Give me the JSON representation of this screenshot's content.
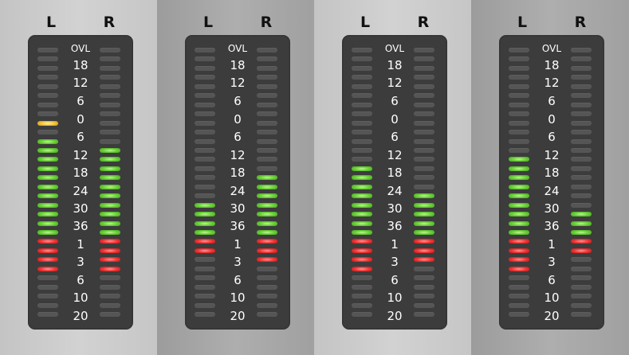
{
  "channel_labels": {
    "left": "L",
    "right": "R"
  },
  "scale_labels": [
    "OVL",
    "18",
    "12",
    "6",
    "0",
    "6",
    "12",
    "18",
    "24",
    "30",
    "36",
    "1",
    "3",
    "6",
    "10",
    "20"
  ],
  "segment_colors": {
    "off": "#555555",
    "green": "#6fd43c",
    "yellow": "#f3c339",
    "red": "#ee3737"
  },
  "meters": [
    {
      "left": {
        "lit": 11,
        "red": 4
      },
      "right": {
        "lit": 10,
        "red": 4
      }
    },
    {
      "left": {
        "lit": 4,
        "red": 2
      },
      "right": {
        "lit": 7,
        "red": 3
      }
    },
    {
      "left": {
        "lit": 8,
        "red": 4
      },
      "right": {
        "lit": 5,
        "red": 3
      }
    },
    {
      "left": {
        "lit": 9,
        "red": 4
      },
      "right": {
        "lit": 3,
        "red": 2
      }
    }
  ]
}
